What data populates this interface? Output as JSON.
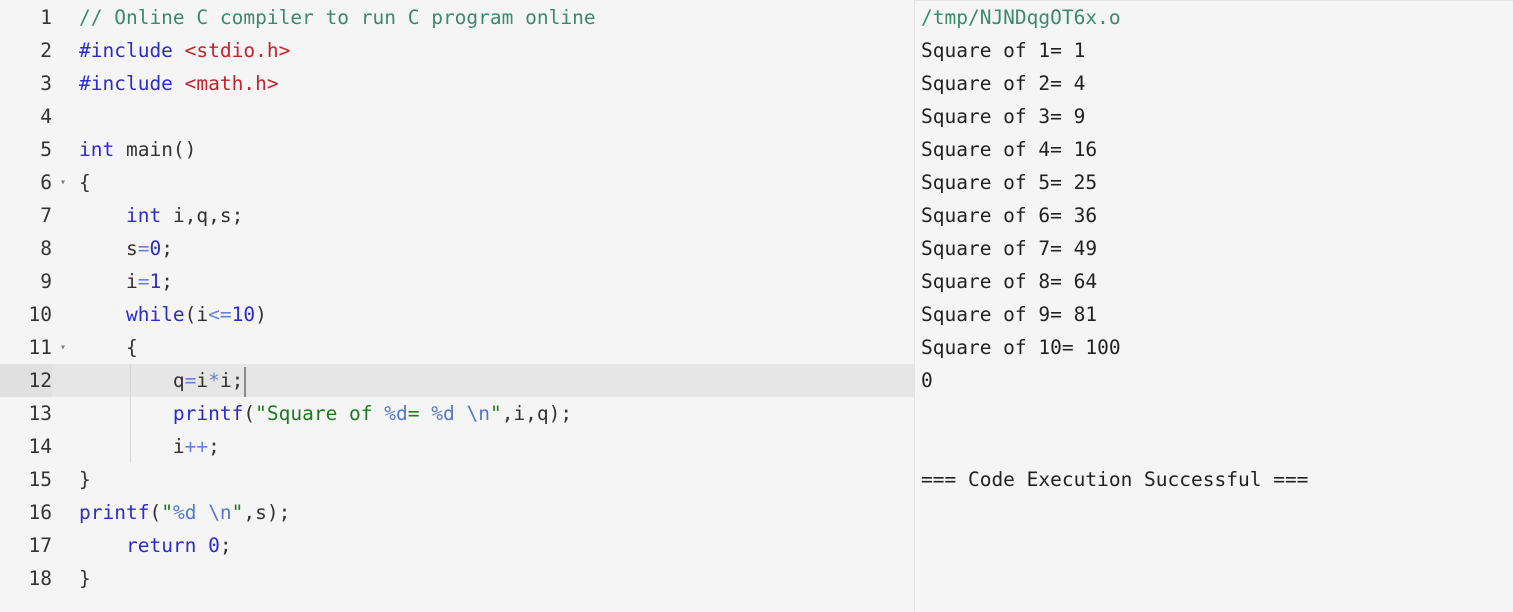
{
  "editor": {
    "lines": [
      {
        "n": "1",
        "fold": "",
        "tokens": [
          {
            "c": "tk-comment",
            "t": "// Online C compiler to run C program online"
          }
        ]
      },
      {
        "n": "2",
        "fold": "",
        "tokens": [
          {
            "c": "tk-kw",
            "t": "#include "
          },
          {
            "c": "tk-inc",
            "t": "<stdio.h>"
          }
        ]
      },
      {
        "n": "3",
        "fold": "",
        "tokens": [
          {
            "c": "tk-kw",
            "t": "#include "
          },
          {
            "c": "tk-inc",
            "t": "<math.h>"
          }
        ]
      },
      {
        "n": "4",
        "fold": "",
        "tokens": []
      },
      {
        "n": "5",
        "fold": "",
        "tokens": [
          {
            "c": "tk-kw",
            "t": "int"
          },
          {
            "c": "",
            "t": " main()"
          }
        ]
      },
      {
        "n": "6",
        "fold": "▾",
        "tokens": [
          {
            "c": "",
            "t": "{"
          }
        ]
      },
      {
        "n": "7",
        "fold": "",
        "indent": 1,
        "tokens": [
          {
            "c": "tk-kw",
            "t": "int"
          },
          {
            "c": "",
            "t": " i,q,s;"
          }
        ]
      },
      {
        "n": "8",
        "fold": "",
        "indent": 1,
        "tokens": [
          {
            "c": "",
            "t": "s"
          },
          {
            "c": "tk-op",
            "t": "="
          },
          {
            "c": "tk-num",
            "t": "0"
          },
          {
            "c": "",
            "t": ";"
          }
        ]
      },
      {
        "n": "9",
        "fold": "",
        "indent": 1,
        "tokens": [
          {
            "c": "",
            "t": "i"
          },
          {
            "c": "tk-op",
            "t": "="
          },
          {
            "c": "tk-num",
            "t": "1"
          },
          {
            "c": "",
            "t": ";"
          }
        ]
      },
      {
        "n": "10",
        "fold": "",
        "indent": 1,
        "tokens": [
          {
            "c": "tk-kw",
            "t": "while"
          },
          {
            "c": "",
            "t": "(i"
          },
          {
            "c": "tk-op",
            "t": "<="
          },
          {
            "c": "tk-num",
            "t": "10"
          },
          {
            "c": "",
            "t": ")"
          }
        ]
      },
      {
        "n": "11",
        "fold": "▾",
        "indent": 1,
        "tokens": [
          {
            "c": "",
            "t": "{"
          }
        ]
      },
      {
        "n": "12",
        "fold": "",
        "indent": 2,
        "active": true,
        "cursor": true,
        "tokens": [
          {
            "c": "",
            "t": "q"
          },
          {
            "c": "tk-op",
            "t": "="
          },
          {
            "c": "",
            "t": "i"
          },
          {
            "c": "tk-op",
            "t": "*"
          },
          {
            "c": "",
            "t": "i;"
          }
        ]
      },
      {
        "n": "13",
        "fold": "",
        "indent": 2,
        "tokens": [
          {
            "c": "tk-fn",
            "t": "printf"
          },
          {
            "c": "",
            "t": "("
          },
          {
            "c": "tk-str",
            "t": "\"Square of "
          },
          {
            "c": "tk-esc",
            "t": "%d"
          },
          {
            "c": "tk-str",
            "t": "= "
          },
          {
            "c": "tk-esc",
            "t": "%d"
          },
          {
            "c": "tk-str",
            "t": " "
          },
          {
            "c": "tk-esc",
            "t": "\\n"
          },
          {
            "c": "tk-str",
            "t": "\""
          },
          {
            "c": "",
            "t": ",i,q);"
          }
        ]
      },
      {
        "n": "14",
        "fold": "",
        "indent": 2,
        "tokens": [
          {
            "c": "",
            "t": "i"
          },
          {
            "c": "tk-op",
            "t": "++"
          },
          {
            "c": "",
            "t": ";"
          }
        ]
      },
      {
        "n": "15",
        "fold": "",
        "tokens": [
          {
            "c": "",
            "t": "}"
          }
        ]
      },
      {
        "n": "16",
        "fold": "",
        "tokens": [
          {
            "c": "tk-fn",
            "t": "printf"
          },
          {
            "c": "",
            "t": "("
          },
          {
            "c": "tk-str",
            "t": "\""
          },
          {
            "c": "tk-esc",
            "t": "%d"
          },
          {
            "c": "tk-str",
            "t": " "
          },
          {
            "c": "tk-esc",
            "t": "\\n"
          },
          {
            "c": "tk-str",
            "t": "\""
          },
          {
            "c": "",
            "t": ",s);"
          }
        ]
      },
      {
        "n": "17",
        "fold": "",
        "indent": 1,
        "tokens": [
          {
            "c": "tk-kw",
            "t": "return"
          },
          {
            "c": "",
            "t": " "
          },
          {
            "c": "tk-num",
            "t": "0"
          },
          {
            "c": "",
            "t": ";"
          }
        ]
      },
      {
        "n": "18",
        "fold": "",
        "tokens": [
          {
            "c": "",
            "t": "}"
          }
        ]
      }
    ]
  },
  "output": {
    "path": "/tmp/NJNDqgOT6x.o",
    "lines": [
      "Square of 1= 1",
      "Square of 2= 4",
      "Square of 3= 9",
      "Square of 4= 16",
      "Square of 5= 25",
      "Square of 6= 36",
      "Square of 7= 49",
      "Square of 8= 64",
      "Square of 9= 81",
      "Square of 10= 100",
      "0"
    ],
    "status": "=== Code Execution Successful ==="
  },
  "colors": {
    "background": "#f5f5f5",
    "active_line": "#e6e6e6",
    "keyword": "#2c2cc8",
    "include_path": "#c3232b",
    "string": "#1e7a1e",
    "comment": "#3b8a6e"
  }
}
